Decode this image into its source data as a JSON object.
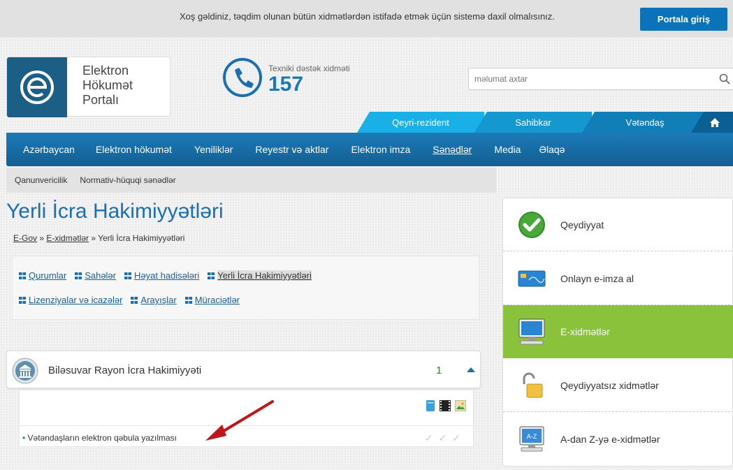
{
  "header": {
    "welcome_text": "Xoş gəldiniz, təqdim olunan bütün xidmətlərdən istifadə etmək üçün sistemə daxil olmalısınız.",
    "login_button": "Portala giriş"
  },
  "logo": {
    "line1": "Elektron",
    "line2": "Hökumət",
    "line3": "Portalı"
  },
  "support": {
    "label": "Texniki dəstək xidməti",
    "number": "157"
  },
  "search": {
    "placeholder": "məlumat axtar"
  },
  "user_tabs": {
    "non_resident": "Qeyri-rezident",
    "entrepreneur": "Sahibkar",
    "citizen": "Vətəndaş"
  },
  "main_nav": [
    "Azərbaycan",
    "Elektron hökumət",
    "Yeniliklər",
    "Reyestr və aktlar",
    "Elektron imza",
    "Sənədlər",
    "Media",
    "Əlaqə"
  ],
  "sub_nav": [
    "Qanunvericilik",
    "Normativ-hüquqi sənədlər"
  ],
  "page": {
    "title": "Yerli İcra Hakimiyyətləri"
  },
  "breadcrumb": {
    "home": "E-Gov",
    "sep1": " » ",
    "services": "E-xidmətlər",
    "sep2": " » ",
    "current": "Yerli İcra Hakimiyyətləri"
  },
  "filters": {
    "row1": [
      "Qurumlar",
      "Sahələr",
      "Həyat hadisələri",
      "Yerli İcra Hakimiyyətləri"
    ],
    "row2": [
      "Lizenziyalar və icazələr",
      "Arayışlar",
      "Müraciətlər"
    ]
  },
  "accordion": {
    "title": "Biləsuvar Rayon İcra Hakimiyyəti",
    "count": "1",
    "service": "Vətəndaşların elektron qəbula yazılması"
  },
  "sidebar": {
    "items": [
      {
        "label": "Qeydiyyat",
        "icon": "check-circle-icon"
      },
      {
        "label": "Onlayn e-imza al",
        "icon": "card-icon"
      },
      {
        "label": "E-xidmətlər",
        "icon": "monitor-icon"
      },
      {
        "label": "Qeydiyyatsız xidmətlər",
        "icon": "unlock-icon"
      },
      {
        "label": "A-dan Z-yə e-xidmətlər",
        "icon": "az-monitor-icon"
      }
    ],
    "active_index": 2
  },
  "colors": {
    "primary": "#1a6fb0",
    "accent_green": "#8ac23b",
    "arrow_red": "#c0141a"
  }
}
